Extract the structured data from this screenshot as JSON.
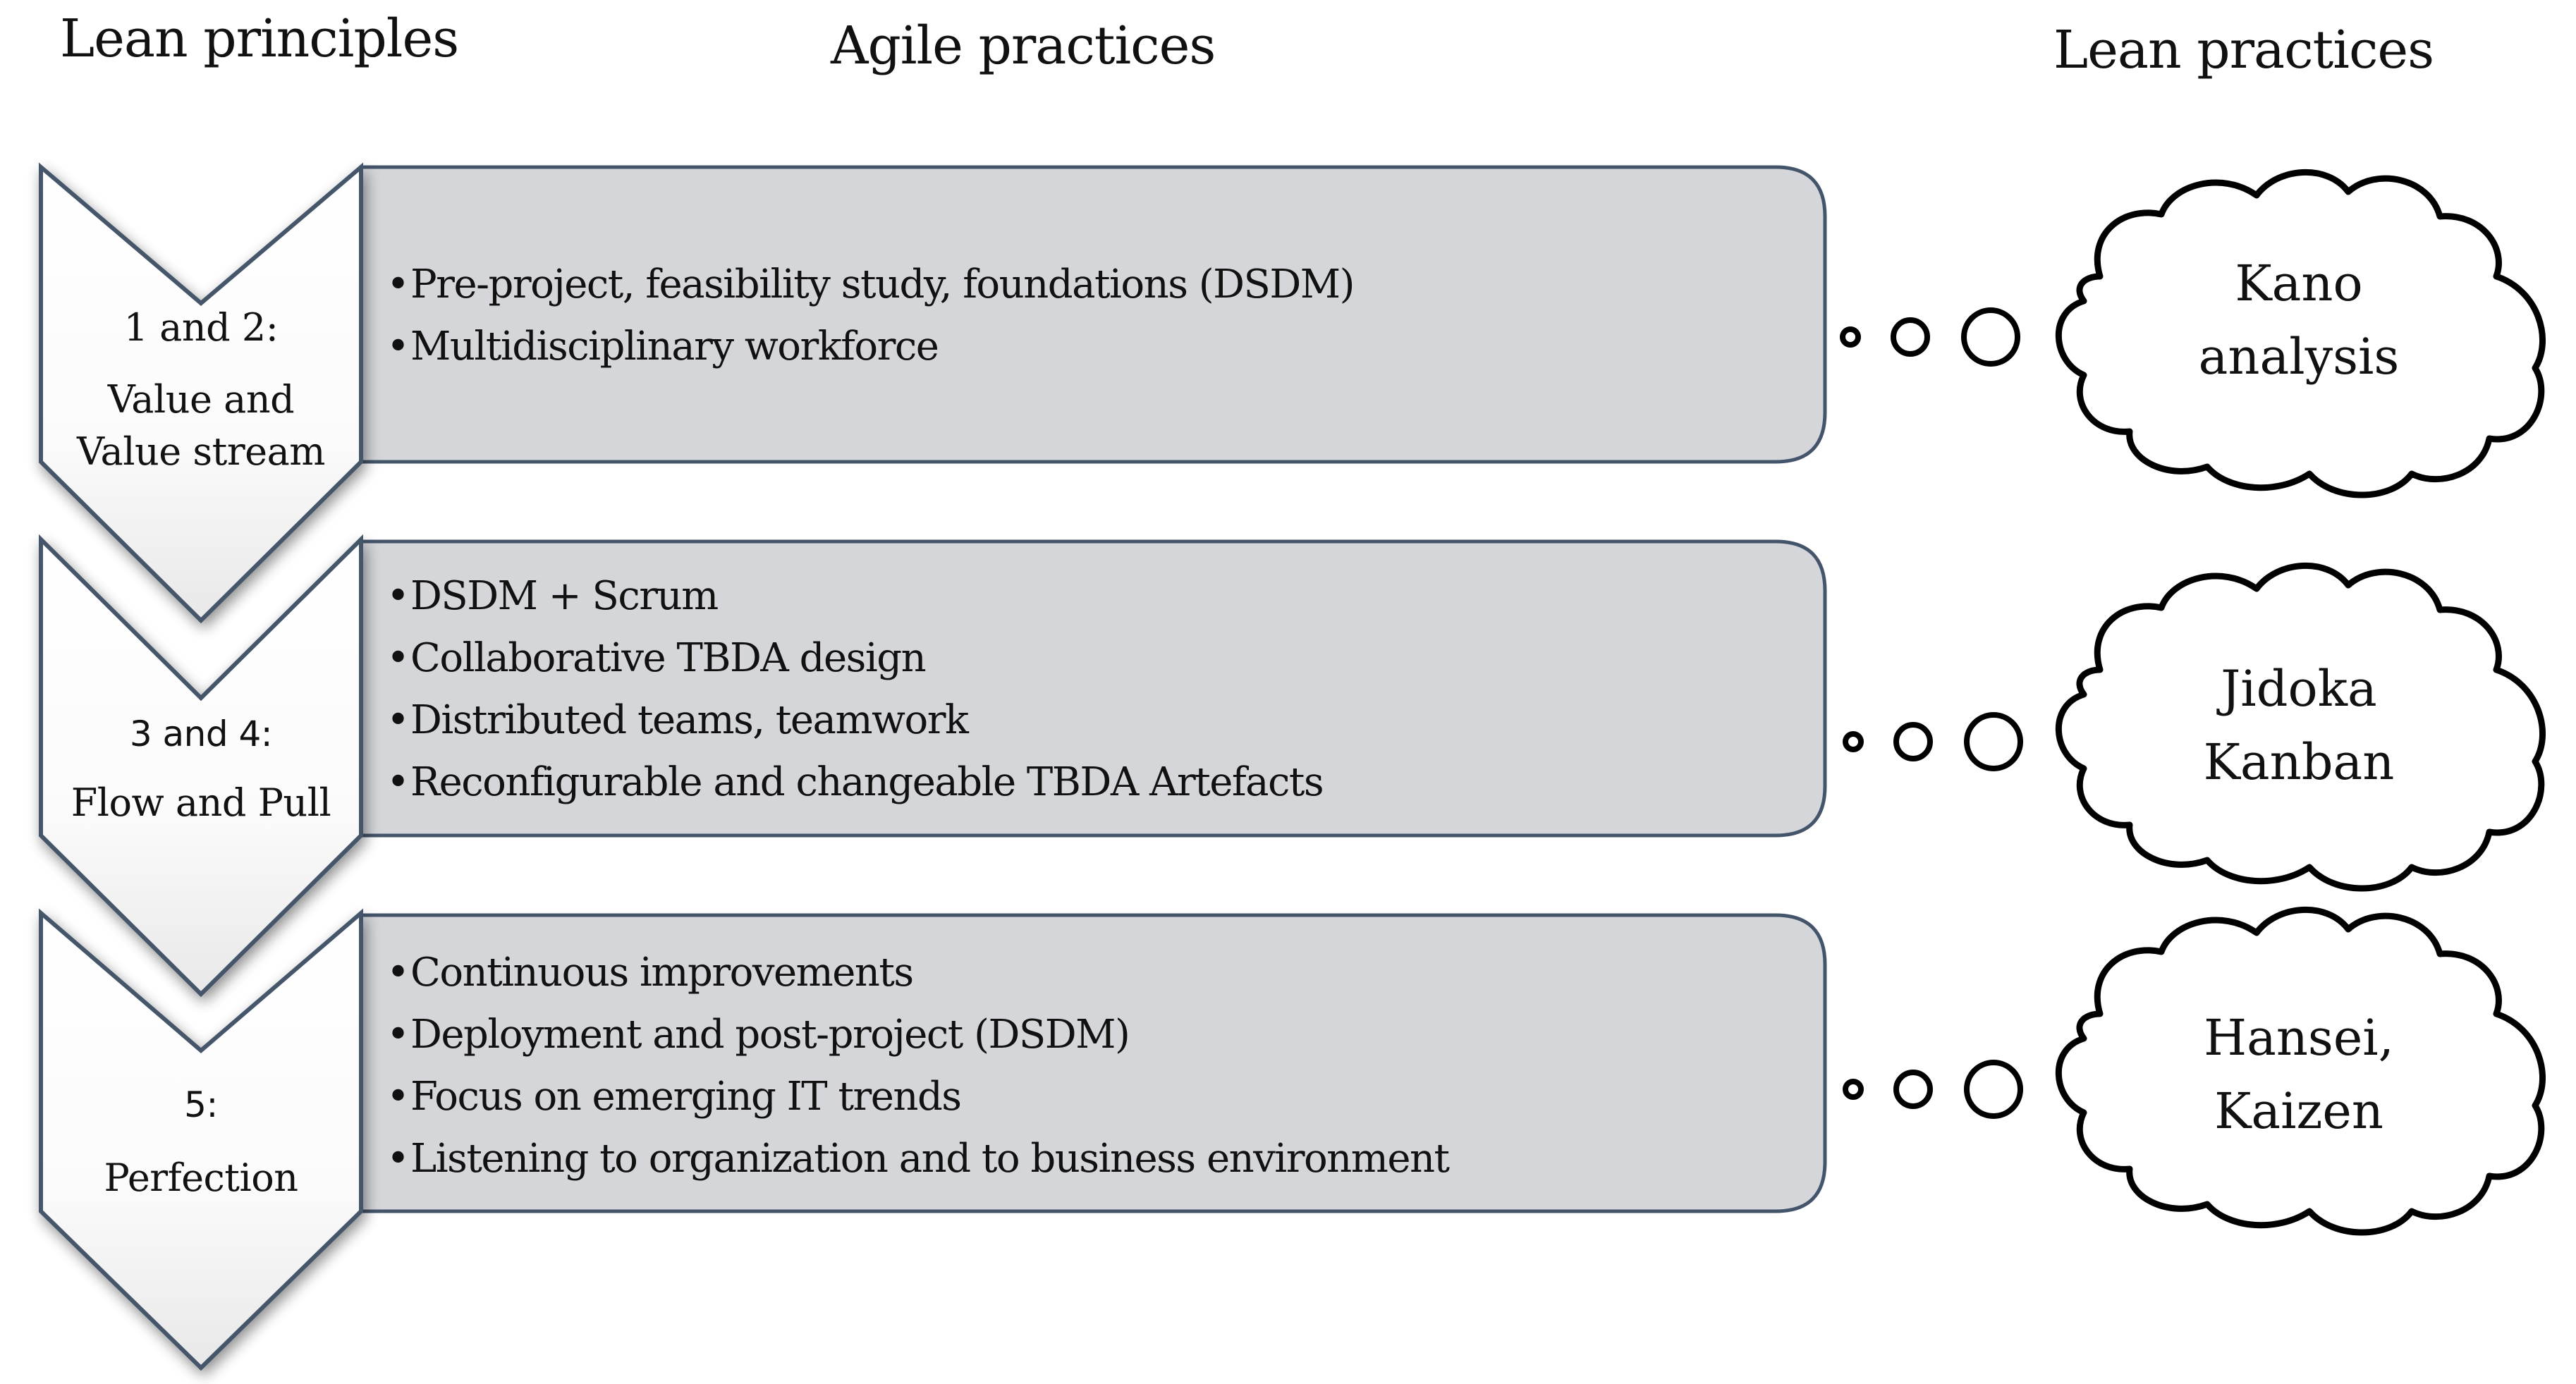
{
  "headers": {
    "lean_principles": "Lean principles",
    "agile_practices": "Agile practices",
    "lean_practices": "Lean practices"
  },
  "rows": [
    {
      "principle_number": "1 and 2:",
      "principle_name_lines": [
        "Value and",
        "Value stream"
      ],
      "agile_items": [
        "Pre-project, feasibility study, foundations (DSDM)",
        "Multidisciplinary workforce"
      ],
      "lean_practice_lines": [
        "Kano",
        "analysis"
      ]
    },
    {
      "principle_number": "3 and 4:",
      "principle_name_lines": [
        "Flow and Pull"
      ],
      "agile_items": [
        "DSDM + Scrum",
        "Collaborative TBDA design",
        "Distributed teams, teamwork",
        "Reconfigurable and changeable TBDA Artefacts"
      ],
      "lean_practice_lines": [
        "Jidoka",
        "Kanban"
      ]
    },
    {
      "principle_number": "5:",
      "principle_name_lines": [
        "Perfection"
      ],
      "agile_items": [
        "Continuous improvements",
        "Deployment and post-project (DSDM)",
        "Focus on emerging IT trends",
        "Listening to organization and to business environment"
      ],
      "lean_practice_lines": [
        "Hansei,",
        "Kaizen"
      ]
    }
  ],
  "bullet_glyph": "•",
  "colors": {
    "box_fill": "#d4d6da",
    "box_stroke": "#44546a",
    "chevron_fill": "#f7f7f7",
    "chevron_stroke": "#44546a",
    "cloud_stroke": "#000000"
  }
}
